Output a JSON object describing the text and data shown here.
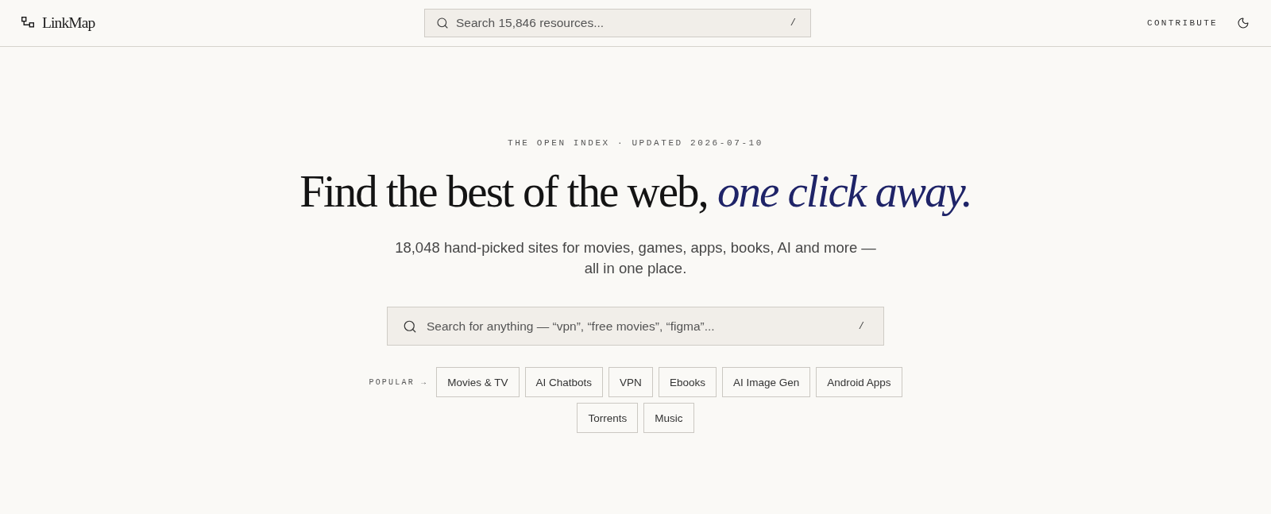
{
  "header": {
    "logo": "LinkMap",
    "search": {
      "placeholder": "Search 15,846 resources...",
      "shortcut": "/"
    },
    "nav": [
      {
        "label": "CONTRIBUTE"
      }
    ]
  },
  "hero": {
    "eyebrow": "THE OPEN INDEX · UPDATED 2026-07-10",
    "headline": "Find the best of the web, *one click away.*",
    "subtitle": "18,048 hand-picked sites for movies, games, apps, books, AI and more — all in one place.",
    "search": {
      "placeholder": "Search for anything — “vpn”, “free movies”, “figma”...",
      "shortcut": "/"
    },
    "popular": {
      "label": "POPULAR →",
      "tags": [
        "Movies & TV",
        "AI Chatbots",
        "VPN",
        "Ebooks",
        "AI Image Gen",
        "Android Apps",
        "Torrents",
        "Music"
      ]
    }
  }
}
